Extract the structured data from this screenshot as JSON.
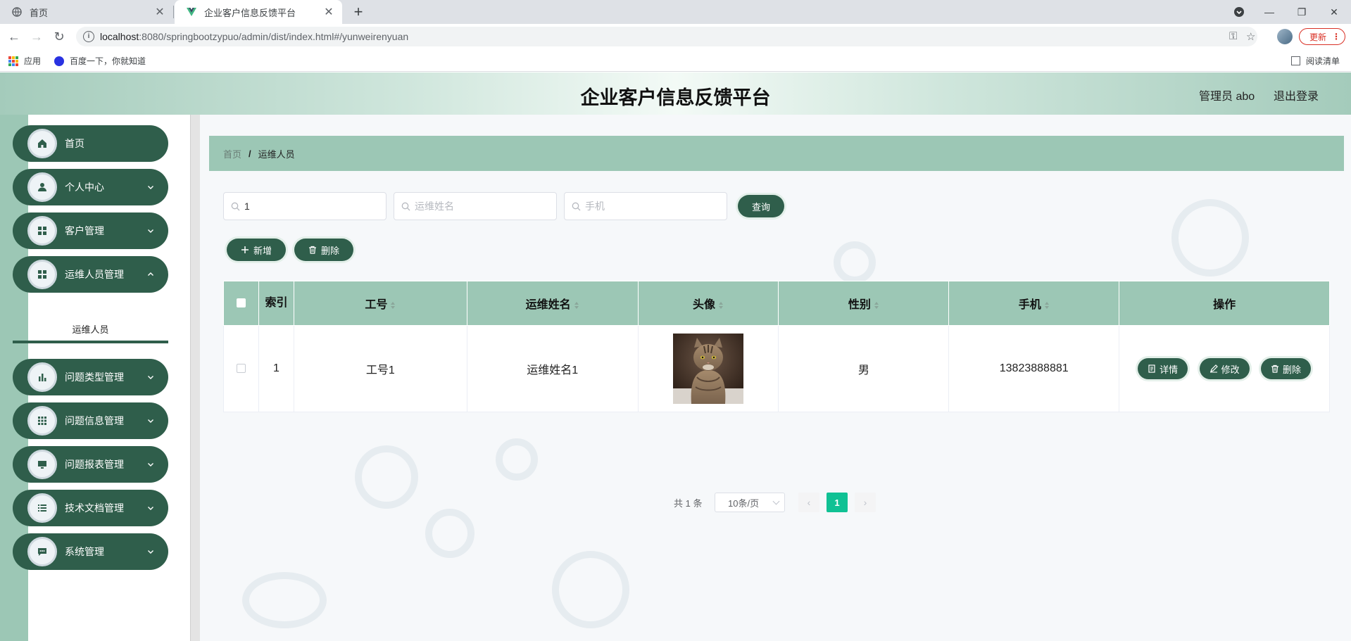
{
  "browser": {
    "tabs": [
      {
        "title": "首页",
        "icon": "globe-icon"
      },
      {
        "title": "企业客户信息反馈平台",
        "icon": "vue-logo-icon"
      }
    ],
    "url_host": "localhost",
    "url_path": ":8080/springbootzypuo/admin/dist/index.html#/yunweirenyuan",
    "update_label": "更新",
    "bookmarks": [
      {
        "label": "应用",
        "icon": "apps-grid-icon"
      },
      {
        "label": "百度一下，你就知道",
        "icon": "baidu-paw-icon"
      }
    ],
    "reading_list_label": "阅读清单"
  },
  "header": {
    "title": "企业客户信息反馈平台",
    "admin_label": "管理员 abo",
    "logout_label": "退出登录"
  },
  "sidebar": {
    "items": [
      {
        "label": "首页",
        "icon": "home-icon",
        "expandable": false
      },
      {
        "label": "个人中心",
        "icon": "user-icon",
        "expandable": true
      },
      {
        "label": "客户管理",
        "icon": "grid-icon",
        "expandable": true
      },
      {
        "label": "运维人员管理",
        "icon": "grid-icon",
        "expandable": true
      },
      {
        "label": "问题类型管理",
        "icon": "bar-chart-icon",
        "expandable": true
      },
      {
        "label": "问题信息管理",
        "icon": "dots-grid-icon",
        "expandable": true
      },
      {
        "label": "问题报表管理",
        "icon": "monitor-icon",
        "expandable": true
      },
      {
        "label": "技术文档管理",
        "icon": "list-icon",
        "expandable": true
      },
      {
        "label": "系统管理",
        "icon": "chat-icon",
        "expandable": true
      }
    ],
    "active_submenu": "运维人员"
  },
  "breadcrumb": {
    "home": "首页",
    "separator": "/",
    "current": "运维人员"
  },
  "search": {
    "field1_value": "1",
    "field2_placeholder": "运维姓名",
    "field3_placeholder": "手机",
    "query_button": "查询"
  },
  "actions": {
    "add_label": "新增",
    "delete_label": "删除"
  },
  "table": {
    "columns": [
      "索引",
      "工号",
      "运维姓名",
      "头像",
      "性别",
      "手机",
      "操作"
    ],
    "rows": [
      {
        "index": "1",
        "job_no": "工号1",
        "name": "运维姓名1",
        "gender": "男",
        "phone": "13823888881"
      }
    ],
    "row_actions": {
      "detail": "详情",
      "edit": "修改",
      "delete": "删除"
    }
  },
  "pagination": {
    "total_label": "共 1 条",
    "page_size": "10条/页",
    "current_page": "1",
    "prev_icon": "chevron-left-icon",
    "next_icon": "chevron-right-icon"
  },
  "colors": {
    "primary": "#2f5e4b",
    "header_green": "#9cc7b5",
    "page_active": "#10c194"
  }
}
